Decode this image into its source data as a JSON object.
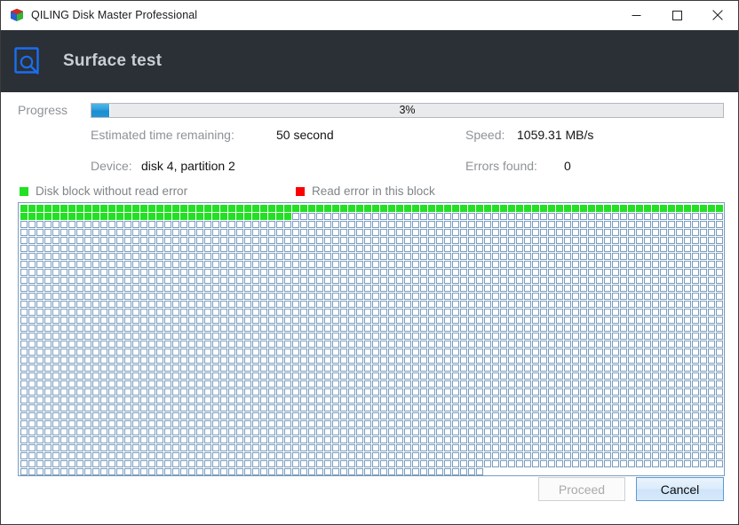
{
  "window": {
    "title": "QILING Disk Master Professional",
    "app_icon": "cube-icon",
    "controls": [
      {
        "name": "minimize",
        "glyph": "minimize-icon"
      },
      {
        "name": "maximize",
        "glyph": "maximize-icon"
      },
      {
        "name": "close",
        "glyph": "close-icon"
      }
    ]
  },
  "header": {
    "title": "Surface test",
    "icon": "surface-test-magnifier-icon",
    "background": "#2b2f36",
    "icon_color": "#1a6ef0",
    "title_color": "#c9cdd4"
  },
  "progress": {
    "label": "Progress",
    "percent_text": "3%",
    "percent_value": 3,
    "fill_color": "#2d9ada",
    "track_color": "#e9eaec"
  },
  "info": {
    "estimated_time_label": "Estimated time remaining:",
    "estimated_time_value": "50 second",
    "speed_label": "Speed:",
    "speed_value": "1059.31 MB/s",
    "device_label": "Device:",
    "device_value": "disk 4, partition 2",
    "errors_label": "Errors found:",
    "errors_value": "0"
  },
  "legend": {
    "ok_label": "Disk block without read error",
    "ok_color": "#22e022",
    "error_label": "Read error in this block",
    "error_color": "#fa0000"
  },
  "block_map": {
    "columns": 88,
    "rows": 34,
    "total_blocks": 2962,
    "scanned_ok_blocks": 122,
    "error_blocks": 0,
    "border_color": "#7a9cc0",
    "empty_fill": "#ffffff"
  },
  "footer": {
    "proceed_label": "Proceed",
    "proceed_disabled": true,
    "cancel_label": "Cancel",
    "cancel_focused": true
  }
}
